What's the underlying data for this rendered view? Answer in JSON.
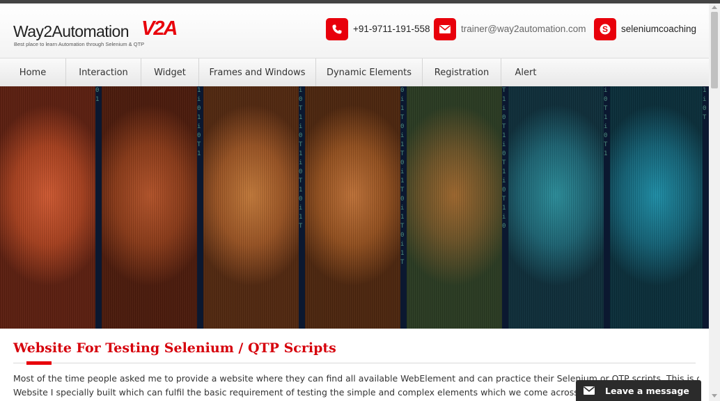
{
  "header": {
    "logo_text": "Way2Automation",
    "logo_mark": "W2A",
    "logo_tagline": "Best place to learn Automation through Selenium & QTP",
    "contacts": [
      {
        "icon": "phone-icon",
        "text": "+91-9711-191-558"
      },
      {
        "icon": "email-icon",
        "text": "trainer@way2automation.com"
      },
      {
        "icon": "skype-icon",
        "text": "seleniumcoaching"
      }
    ]
  },
  "nav": {
    "items": [
      {
        "label": "Home"
      },
      {
        "label": "Interaction"
      },
      {
        "label": "Widget"
      },
      {
        "label": "Frames and Windows"
      },
      {
        "label": "Dynamic Elements"
      },
      {
        "label": "Registration"
      },
      {
        "label": "Alert"
      }
    ]
  },
  "main": {
    "title": "Website For Testing Selenium / QTP Scripts",
    "paragraph_lines": [
      "Most of the time people asked me to provide a website where they can find all available WebElement and can practice their Selenium or QTP scripts. This is one of the",
      "Website I specially built which can fulfil the basic requirement of testing the simple and complex elements which we come across mostly while"
    ]
  },
  "chat": {
    "label": "Leave a message"
  },
  "colors": {
    "accent": "#e8000b",
    "title": "#d6000b",
    "topbar": "#444444",
    "chat_bg": "#2b2b2b"
  }
}
